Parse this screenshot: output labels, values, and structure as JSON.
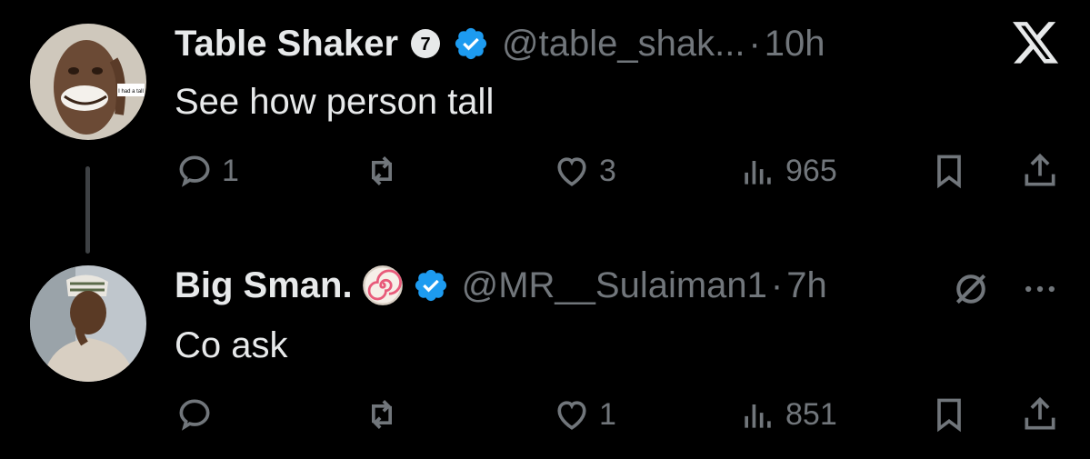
{
  "colors": {
    "background": "#000000",
    "text": "#e7e9ea",
    "muted": "#71767b",
    "verified": "#1d9bf0",
    "thread_line": "#3e4144"
  },
  "close_icon": "x-logo-icon",
  "tweets": [
    {
      "name": "Table Shaker",
      "badge_icon": "affiliate-badge-icon",
      "badge_number": "7",
      "verified_icon": "verified-badge-icon",
      "handle": "@table_shak...",
      "separator": "·",
      "time": "10h",
      "text": "See how person tall",
      "avatar_caption": "I had a tall",
      "metrics": {
        "replies": "1",
        "retweets": "",
        "likes": "3",
        "views": "965"
      }
    },
    {
      "name": "Big Sman.",
      "badge_icon": "swirl-emoji-icon",
      "verified_icon": "verified-badge-icon",
      "handle": "@MR__Sulaiman1",
      "separator": "·",
      "time": "7h",
      "text": "Co ask",
      "header_icons": [
        "grok-icon",
        "more-icon"
      ],
      "metrics": {
        "replies": "",
        "retweets": "",
        "likes": "1",
        "views": "851"
      }
    }
  ]
}
